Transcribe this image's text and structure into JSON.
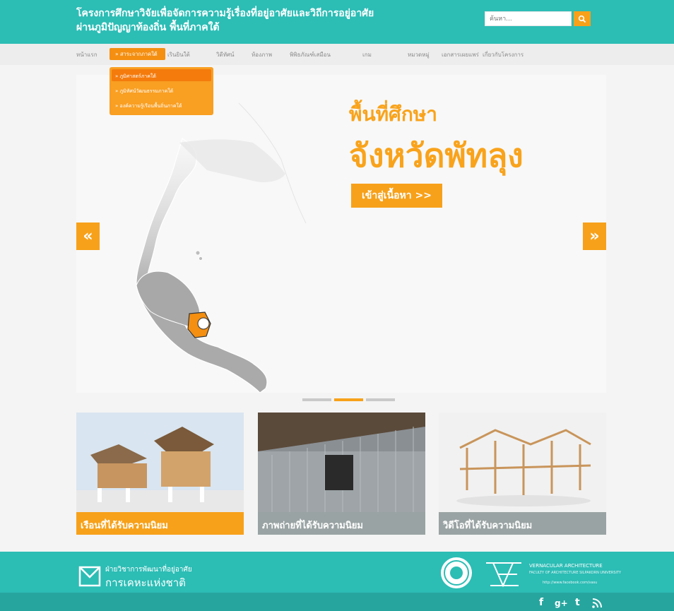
{
  "header": {
    "title_line1": "โครงการศึกษาวิจัยเพื่อจัดการความรู้เรื่องที่อยู่อาศัยและวิถีการอยู่อาศัย",
    "title_line2": "ผ่านภูมิปัญญาท้องถิ่น พื้นที่ภาคใต้",
    "search_placeholder": "ค้นหา..."
  },
  "nav": {
    "items": [
      "หน้าแรก",
      "สาระจากภาคใต้",
      "เรินยินใต้",
      "วิดีทัศน์",
      "ห้องภาพ",
      "พิพิธภัณฑ์เสมือน",
      "เกม",
      "หมวดหมู่",
      "เอกสารเผยแพร่",
      "เกี่ยวกับโครงการ"
    ],
    "active_label": "» สาระจากภาคใต้"
  },
  "dropdown": {
    "items": [
      "» ภูมิศาสตร์ภาคใต้",
      "» ภูมิทัศน์วัฒนธรรมภาคใต้",
      "» องค์ความรู้เรือนพื้นถิ่นภาคใต้"
    ]
  },
  "slider": {
    "headline_small": "พื้นที่ศึกษา",
    "headline_big": "จังหวัดพัทลุง",
    "enter_button": "เข้าสู่เนื้อหา >>",
    "prev_symbol": "«",
    "next_symbol": "»"
  },
  "cards": [
    {
      "caption": "เรือนที่ได้รับความนิยม"
    },
    {
      "caption": "ภาพถ่ายที่ได้รับความนิยม"
    },
    {
      "caption": "วิดีโอที่ได้รับความนิยม"
    }
  ],
  "footer": {
    "org_line1": "ฝ่ายวิชาการพัฒนาที่อยู่อาศัย",
    "org_line2": "การเคหะแห่งชาติ",
    "va_title": "VERNACULAR ARCHITECTURE",
    "va_sub": "FACULTY OF ARCHITECTURE SILPAKORN UNIVERSITY",
    "va_url": "http://www.facebook.com/vasu",
    "social": [
      "f",
      "g+",
      "t",
      "rss"
    ]
  },
  "colors": {
    "teal": "#2cbdb5",
    "orange": "#f7a11a",
    "highlight": "#f47b0c"
  }
}
